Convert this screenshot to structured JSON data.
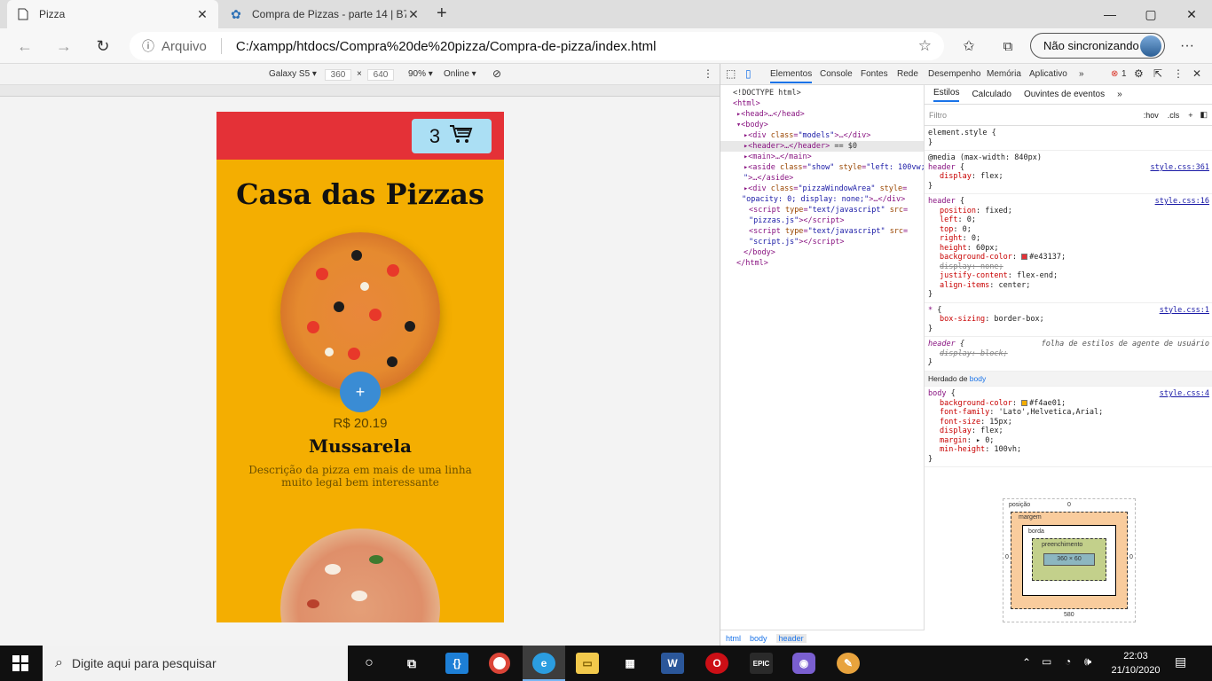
{
  "browser": {
    "tabs": [
      {
        "title": "Pizza",
        "active": true
      },
      {
        "title": "Compra de Pizzas - parte 14 | B7",
        "active": false
      }
    ],
    "new_tab": "+",
    "window_controls": {
      "minimize": "—",
      "maximize": "▢",
      "close": "✕"
    },
    "address": {
      "info_icon": "ⓘ",
      "scheme": "Arquivo",
      "url": "C:/xampp/htdocs/Compra%20de%20pizza/Compra-de-pizza/index.html"
    },
    "sync_label": "Não sincronizando",
    "more": "···"
  },
  "emulation": {
    "device": "Galaxy S5 ▾",
    "width": "360",
    "x": "×",
    "height": "640",
    "zoom": "90% ▾",
    "network": "Online ▾"
  },
  "site": {
    "cart_count": "3",
    "title": "Casa das Pizzas",
    "add_label": "+",
    "price": "R$ 20.19",
    "name": "Mussarela",
    "description": "Descrição da pizza em mais de uma linha muito legal bem interessante"
  },
  "devtools": {
    "tabs": [
      "Elementos",
      "Console",
      "Fontes",
      "Rede",
      "Desempenho",
      "Memória",
      "Aplicativo",
      "»"
    ],
    "error_count": "1",
    "style_tabs": [
      "Estilos",
      "Calculado",
      "Ouvintes de eventos",
      "»"
    ],
    "filter_placeholder": "Filtro",
    "hov": ":hov",
    "cls": ".cls",
    "breadcrumbs": [
      "html",
      "body",
      "header"
    ],
    "inherited_label": "Herdado de",
    "inherited_from": "body",
    "boxmodel": {
      "position_label": "posição",
      "position": "0",
      "margin_label": "margem",
      "border_label": "borda",
      "padding_label": "preenchimento",
      "content": "360 × 60",
      "dash": "–",
      "bottom": "580",
      "zero": "0"
    }
  },
  "taskbar": {
    "search_placeholder": "Digite aqui para pesquisar",
    "time": "22:03",
    "date": "21/10/2020"
  }
}
